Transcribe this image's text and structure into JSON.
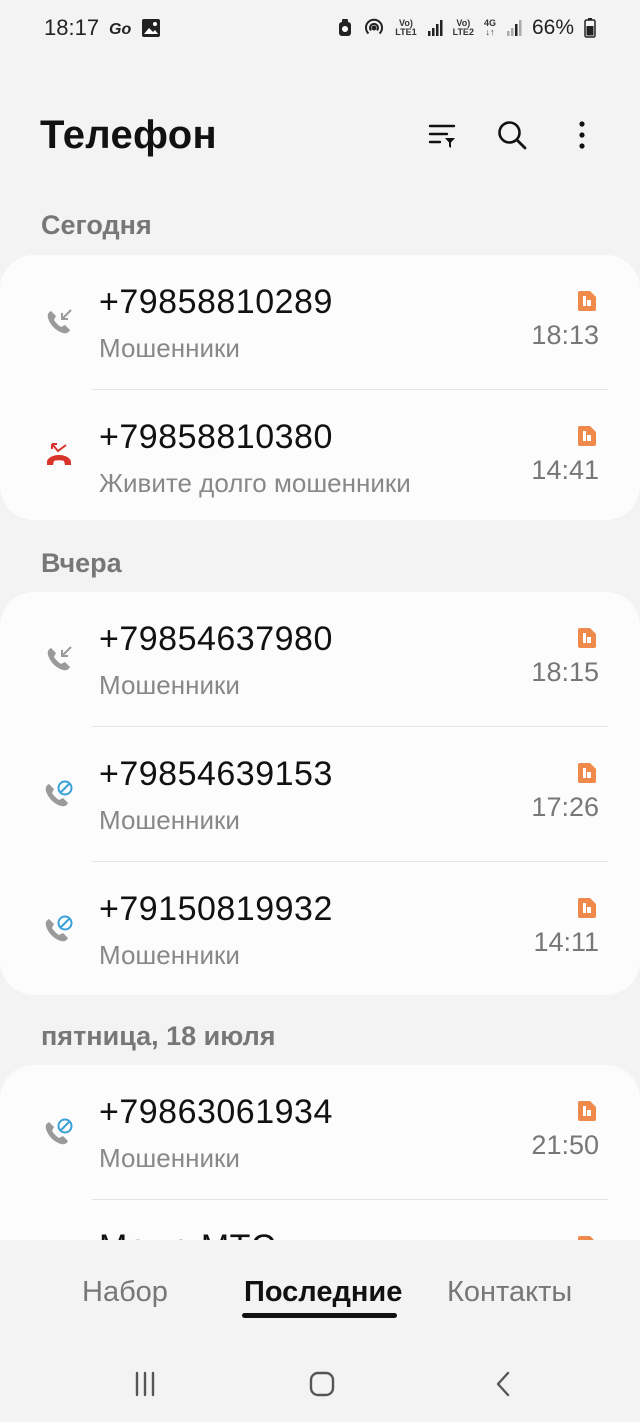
{
  "status_bar": {
    "time": "18:17",
    "net1_top": "Vo)",
    "net1_bottom": "LTE1",
    "net2_top": "Vo)",
    "net2_bottom": "LTE2",
    "net2_type": "4G",
    "battery": "66%"
  },
  "header": {
    "title": "Телефон",
    "icons": [
      "filter-icon",
      "search-icon",
      "more-vertical-icon"
    ]
  },
  "sections": [
    {
      "label": "Сегодня",
      "calls": [
        {
          "number": "+79858810289",
          "name": "Мошенники",
          "time": "18:13",
          "type": "incoming"
        },
        {
          "number": "+79858810380",
          "name": "Живите долго мошенники",
          "time": "14:41",
          "type": "rejected"
        }
      ]
    },
    {
      "label": "Вчера",
      "calls": [
        {
          "number": "+79854637980",
          "name": "Мошенники",
          "time": "18:15",
          "type": "incoming"
        },
        {
          "number": "+79854639153",
          "name": "Мошенники",
          "time": "17:26",
          "type": "blocked"
        },
        {
          "number": "+79150819932",
          "name": "Мошенники",
          "time": "14:11",
          "type": "blocked"
        }
      ]
    },
    {
      "label": "пятница, 18 июля",
      "calls": [
        {
          "number": "+79863061934",
          "name": "Мошенники",
          "time": "21:50",
          "type": "blocked"
        },
        {
          "number": "Мама МТС",
          "name": "",
          "time": "",
          "type": "outgoing"
        }
      ]
    }
  ],
  "tabs": {
    "dialer": "Набор",
    "recents": "Последние",
    "contacts": "Контакты",
    "active": "recents"
  },
  "colors": {
    "background": "#f3f3f3",
    "card": "#fcfcfc",
    "missed_red": "#d9342b",
    "blocked_blue": "#3aa0d8",
    "sim_orange": "#ef8a4a",
    "outgoing_green": "#2db37a"
  }
}
